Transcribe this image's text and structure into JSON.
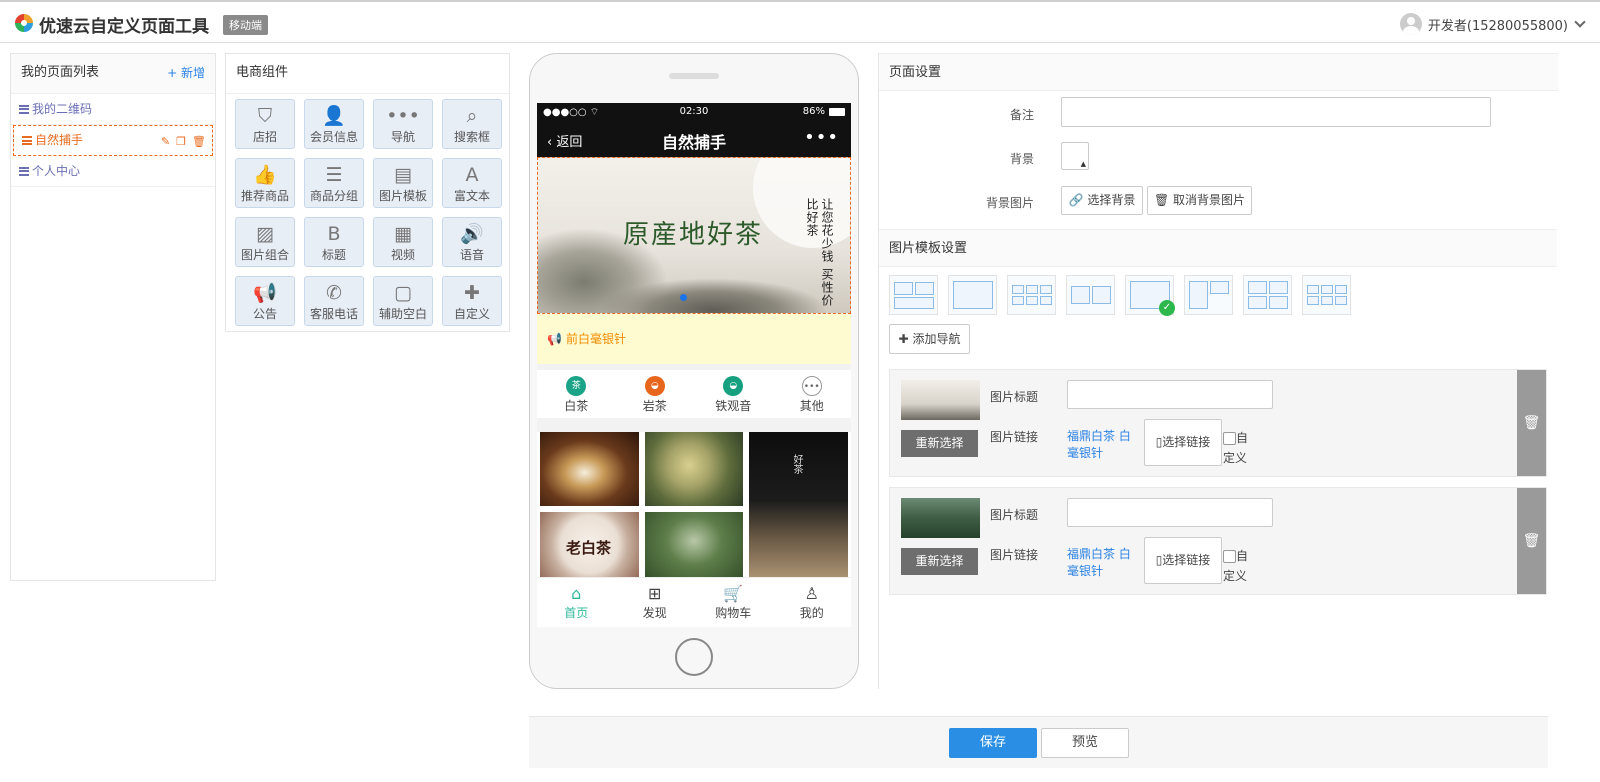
{
  "header": {
    "app_title": "优速云自定义页面工具",
    "badge": "移动端",
    "user": "开发者(15280055800)"
  },
  "pages": {
    "title": "我的页面列表",
    "add": "+ 新增",
    "items": [
      {
        "label": "我的二维码"
      },
      {
        "label": "自然捕手"
      },
      {
        "label": "个人中心"
      }
    ]
  },
  "components": {
    "title": "电商组件",
    "items": [
      {
        "label": "店招",
        "icon": "bookmark-icon",
        "glyph": "⛉"
      },
      {
        "label": "会员信息",
        "icon": "user-icon",
        "glyph": "👤"
      },
      {
        "label": "导航",
        "icon": "dots-icon",
        "glyph": "•••"
      },
      {
        "label": "搜索框",
        "icon": "search-icon",
        "glyph": "⌕"
      },
      {
        "label": "推荐商品",
        "icon": "thumbs-up-icon",
        "glyph": "👍"
      },
      {
        "label": "商品分组",
        "icon": "list-icon",
        "glyph": "☰"
      },
      {
        "label": "图片模板",
        "icon": "image-file-icon",
        "glyph": "▤"
      },
      {
        "label": "富文本",
        "icon": "font-icon",
        "glyph": "A"
      },
      {
        "label": "图片组合",
        "icon": "picture-icon",
        "glyph": "▨"
      },
      {
        "label": "标题",
        "icon": "bold-icon",
        "glyph": "B"
      },
      {
        "label": "视频",
        "icon": "film-icon",
        "glyph": "▦"
      },
      {
        "label": "语音",
        "icon": "volume-icon",
        "glyph": "🔊"
      },
      {
        "label": "公告",
        "icon": "megaphone-icon",
        "glyph": "📢"
      },
      {
        "label": "客服电话",
        "icon": "phone-icon",
        "glyph": "✆"
      },
      {
        "label": "辅助空白",
        "icon": "square-icon",
        "glyph": "▢"
      },
      {
        "label": "自定义",
        "icon": "puzzle-icon",
        "glyph": "✚"
      }
    ]
  },
  "phone": {
    "status": {
      "carrier": "●●●○○ ⌔",
      "time": "02:30",
      "battery": "86%"
    },
    "nav": {
      "back": "返回",
      "title": "自然捕手",
      "more": "•••"
    },
    "banner": {
      "title": "原産地好茶",
      "side": "让您花少钱 买性价比好茶"
    },
    "notice": "前白毫银针",
    "categories": [
      {
        "label": "白茶",
        "color": "#1aa386",
        "glyph": "茶"
      },
      {
        "label": "岩茶",
        "color": "#e8661c",
        "glyph": "◒"
      },
      {
        "label": "铁观音",
        "color": "#17a080",
        "glyph": "◒"
      },
      {
        "label": "其他",
        "color": "#ffffff",
        "glyph": "•••"
      }
    ],
    "tabs": [
      {
        "label": "首页",
        "glyph": "⌂"
      },
      {
        "label": "发现",
        "glyph": "⊞"
      },
      {
        "label": "购物车",
        "glyph": "🛒"
      },
      {
        "label": "我的",
        "glyph": "♙"
      }
    ],
    "img_text": {
      "cake": "老白茶",
      "good": "好茶"
    }
  },
  "settings": {
    "title": "页面设置",
    "note_label": "备注",
    "bg_label": "背景",
    "bgimg_label": "背景图片",
    "choose_bg": "选择背景",
    "cancel_bg": "取消背景图片",
    "tpl_title": "图片模板设置",
    "add_nav": "添加导航",
    "items": [
      {
        "img_title_label": "图片标题",
        "img_link_label": "图片链接",
        "reselect": "重新选择",
        "link_text": "福鼎白茶 白毫银针",
        "choose_link": "选择链接",
        "custom": "自定义"
      },
      {
        "img_title_label": "图片标题",
        "img_link_label": "图片链接",
        "reselect": "重新选择",
        "link_text": "福鼎白茶 白毫银针",
        "choose_link": "选择链接",
        "custom": "自定义"
      }
    ]
  },
  "footer": {
    "save": "保存",
    "preview": "预览"
  }
}
